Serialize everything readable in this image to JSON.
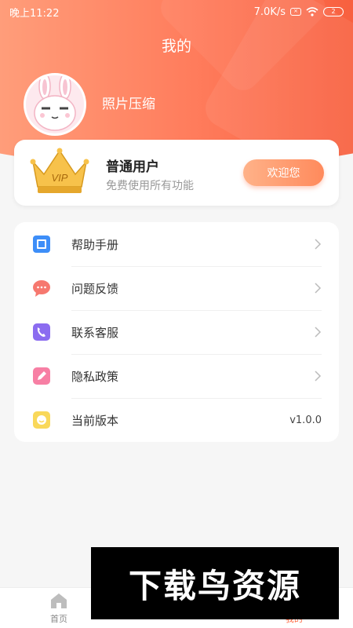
{
  "status_bar": {
    "time": "晚上11:22",
    "network_speed": "7.0K/s",
    "battery": "2"
  },
  "header": {
    "title": "我的"
  },
  "profile": {
    "name": "照片压缩",
    "avatar_icon": "rabbit-avatar-icon"
  },
  "vip": {
    "crown_icon": "vip-crown-icon",
    "crown_text": "VIP",
    "title": "普通用户",
    "subtitle": "免费使用所有功能",
    "button_label": "欢迎您"
  },
  "menu": {
    "items": [
      {
        "label": "帮助手册",
        "icon": "book-icon",
        "color": "#3d8ef8"
      },
      {
        "label": "问题反馈",
        "icon": "chat-bubble-icon",
        "color": "#f6786f"
      },
      {
        "label": "联系客服",
        "icon": "phone-icon",
        "color": "#8b6cf0"
      },
      {
        "label": "隐私政策",
        "icon": "pencil-icon",
        "color": "#f77fa4"
      },
      {
        "label": "当前版本",
        "icon": "smiley-icon",
        "color": "#f9d85a",
        "value": "v1.0.0"
      }
    ]
  },
  "tabbar": {
    "tabs": [
      {
        "label": "首页",
        "icon": "home-icon"
      },
      {
        "label": "我的",
        "icon": "user-icon",
        "active": true
      }
    ]
  },
  "watermark": {
    "text": "下载鸟资源"
  },
  "colors": {
    "accent": "#ff7c5c",
    "background": "#f6f6f6"
  }
}
